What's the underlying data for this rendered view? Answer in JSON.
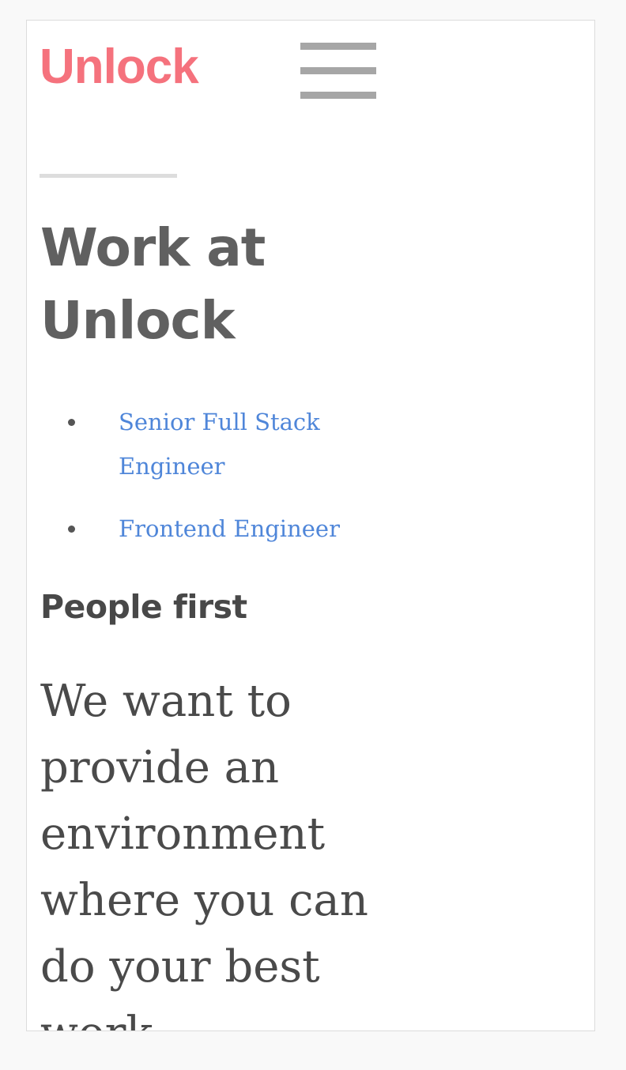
{
  "header": {
    "logo_text": "Unlock",
    "menu_label": "Menu"
  },
  "colors": {
    "brand": "#f5727d",
    "link": "#4f86d9",
    "heading": "#606060",
    "body_text": "#4a4a4a",
    "menu_icon": "#a6a6a6"
  },
  "icons": {
    "menu": "hamburger-icon"
  },
  "main": {
    "title": "Work at Unlock",
    "jobs": [
      {
        "label": "Senior Full Stack Engineer"
      },
      {
        "label": "Frontend Engineer"
      }
    ],
    "section_heading": "People first",
    "lead_text": "We want to provide an environment where you can do your best work."
  }
}
